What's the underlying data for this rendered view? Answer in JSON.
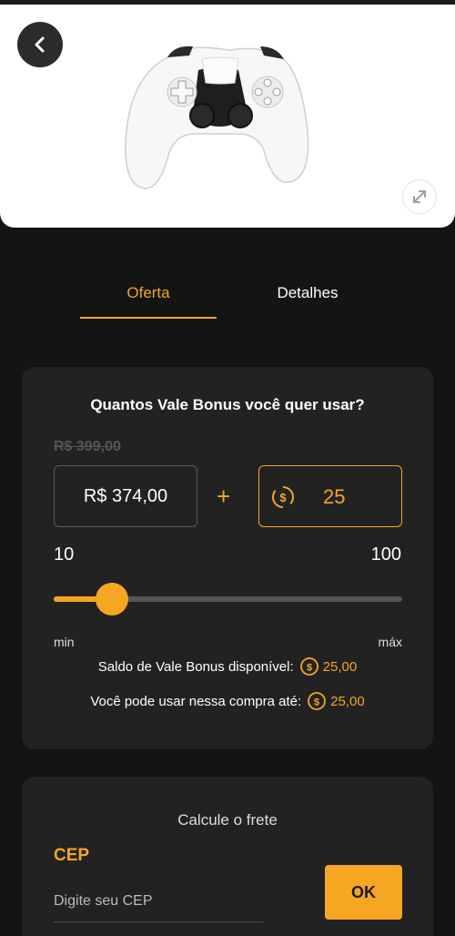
{
  "tabs": {
    "offer": "Oferta",
    "details": "Detalhes"
  },
  "bonus": {
    "question": "Quantos Vale Bonus você quer usar?",
    "old_price": "R$ 399,00",
    "price": "R$ 374,00",
    "plus": "+",
    "bonus_value": "25",
    "range_min": "10",
    "range_max": "100",
    "slider_value": 25,
    "label_min": "min",
    "label_max": "máx",
    "balance_label": "Saldo de Vale Bonus disponível:",
    "balance_value": "25,00",
    "usable_label": "Você pode usar nessa compra até:",
    "usable_value": "25,00"
  },
  "shipping": {
    "title": "Calcule o frete",
    "cep_label": "CEP",
    "cep_placeholder": "Digite seu CEP",
    "ok_label": "OK"
  },
  "colors": {
    "accent": "#f5a623",
    "background": "#141414",
    "card": "#222222"
  }
}
